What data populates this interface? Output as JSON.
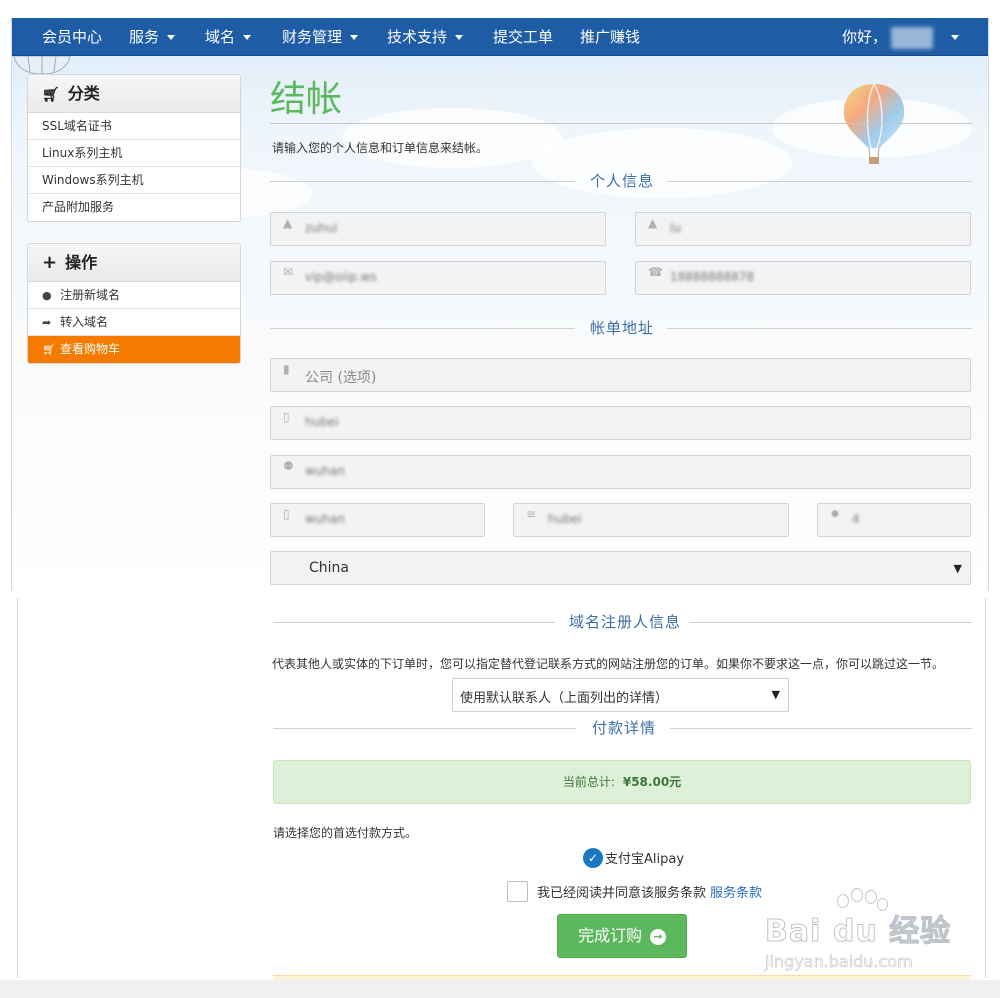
{
  "nav": {
    "items": [
      {
        "label": "会员中心",
        "dropdown": false
      },
      {
        "label": "服务",
        "dropdown": true
      },
      {
        "label": "域名",
        "dropdown": true
      },
      {
        "label": "财务管理",
        "dropdown": true
      },
      {
        "label": "技术支持",
        "dropdown": true
      },
      {
        "label": "提交工单",
        "dropdown": false
      },
      {
        "label": "推广赚钱",
        "dropdown": false
      }
    ],
    "greeting": "你好，",
    "username": "",
    "bg_color": "#1e5ca6"
  },
  "sidebar": {
    "categories": {
      "title": "分类",
      "icon": "cart-icon",
      "items": [
        "SSL域名证书",
        "Linux系列主机",
        "Windows系列主机",
        "产品附加服务"
      ]
    },
    "actions": {
      "title": "操作",
      "icon": "plus-icon",
      "items": [
        {
          "label": "注册新域名",
          "icon": "globe-icon",
          "active": false
        },
        {
          "label": "转入域名",
          "icon": "share-arrow-icon",
          "active": false
        },
        {
          "label": "查看购物车",
          "icon": "cart-icon",
          "active": true
        }
      ]
    },
    "active_color": "#f47b00"
  },
  "main": {
    "title": "结帐",
    "intro": "请输入您的个人信息和订单信息来结帐。",
    "personal": {
      "heading": "个人信息",
      "first_name": "zuhui",
      "last_name": "lu",
      "email": "vip@oiip.ws",
      "phone": "18888888878"
    },
    "billing": {
      "heading": "帐单地址",
      "company_placeholder": "公司 (选项)",
      "address1": "hubei",
      "address2": "wuhan",
      "city": "wuhan",
      "state": "hubei",
      "postcode": "4",
      "country": "China"
    },
    "registrant": {
      "heading": "域名注册人信息",
      "description": "代表其他人或实体的下订单时，您可以指定替代登记联系方式的网站注册您的订单。如果你不要求这一点，你可以跳过这一节。",
      "contact_option": "使用默认联系人（上面列出的详情）"
    },
    "payment": {
      "heading": "付款详情",
      "total_label": "当前总计:",
      "total_value": "¥58.00元",
      "method_prompt": "请选择您的首选付款方式。",
      "method": "支付宝Alipay",
      "tos_text": "我已经阅读并同意该服务条款",
      "tos_link": "服务条款",
      "submit": "完成订购",
      "accent_color": "#5cb85c"
    }
  },
  "watermark": {
    "brand": "Bai du 经验",
    "url": "jingyan.baidu.com"
  }
}
